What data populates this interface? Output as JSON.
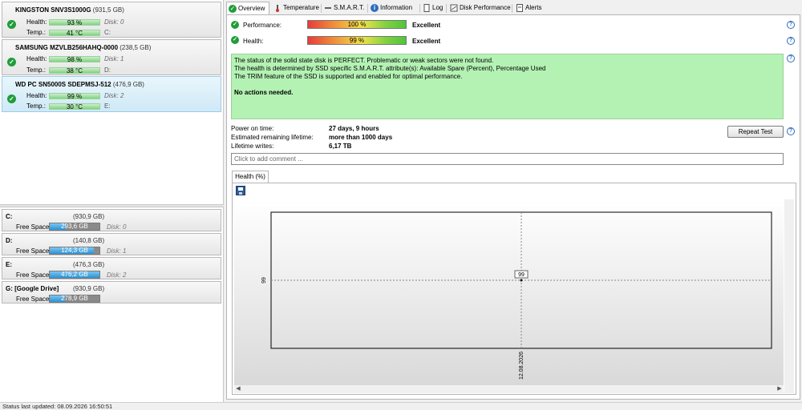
{
  "disks": [
    {
      "name": "KINGSTON SNV3S1000G",
      "size": "(931,5 GB)",
      "health_label": "Health:",
      "health": "93 %",
      "health_pct": 93,
      "temp_label": "Temp.:",
      "temp": "41 °C",
      "disk": "Disk: 0",
      "drive": "C:"
    },
    {
      "name": "SAMSUNG MZVLB256HAHQ-0000",
      "size": "(238,5 GB)",
      "health_label": "Health:",
      "health": "98 %",
      "health_pct": 98,
      "temp_label": "Temp.:",
      "temp": "38 °C",
      "disk": "Disk: 1",
      "drive": "D:"
    },
    {
      "name": "WD PC SN5000S SDEPMSJ-512",
      "size": "(476,9 GB)",
      "health_label": "Health:",
      "health": "99 %",
      "health_pct": 99,
      "temp_label": "Temp.:",
      "temp": "30 °C",
      "disk": "Disk: 2",
      "drive": "E:"
    }
  ],
  "volumes": [
    {
      "letter": "C:",
      "size": "(930,9 GB)",
      "free_label": "Free Space",
      "free": "293,6 GB",
      "free_pct": 32,
      "disk": "Disk: 0"
    },
    {
      "letter": "D:",
      "size": "(140,8 GB)",
      "free_label": "Free Space",
      "free": "124,3 GB",
      "free_pct": 88,
      "disk": "Disk: 1"
    },
    {
      "letter": "E:",
      "size": "(476,3 GB)",
      "free_label": "Free Space",
      "free": "476,2 GB",
      "free_pct": 100,
      "disk": "Disk: 2"
    },
    {
      "letter": "G: [Google Drive]",
      "size": "(930,9 GB)",
      "free_label": "Free Space",
      "free": "278,9 GB",
      "free_pct": 30,
      "disk": ""
    }
  ],
  "status_bar": "Status last updated: 08.09.2026 16:50:51",
  "tabs": [
    {
      "label": "Overview",
      "icon": "check-icon"
    },
    {
      "label": "Temperature",
      "icon": "thermometer-icon"
    },
    {
      "label": "S.M.A.R.T.",
      "icon": "smart-icon"
    },
    {
      "label": "Information",
      "icon": "info-icon"
    },
    {
      "label": "Log",
      "icon": "document-icon"
    },
    {
      "label": "Disk Performance",
      "icon": "disk-performance-icon"
    },
    {
      "label": "Alerts",
      "icon": "alerts-icon"
    }
  ],
  "overview": {
    "performance_label": "Performance:",
    "performance_value": "100 %",
    "performance_pct": 100,
    "performance_rating": "Excellent",
    "health_label": "Health:",
    "health_value": "99 %",
    "health_pct": 99,
    "health_rating": "Excellent",
    "message_lines": [
      "The status of the solid state disk is PERFECT. Problematic or weak sectors were not found.",
      "The health is determined by SSD specific S.M.A.R.T. attribute(s):  Available Spare (Percent), Percentage Used",
      "The TRIM feature of the SSD is supported and enabled for optimal performance."
    ],
    "message_action": "No actions needed.",
    "power_on_label": "Power on time:",
    "power_on_value": "27 days, 9 hours",
    "lifetime_label": "Estimated remaining lifetime:",
    "lifetime_value": "more than 1000 days",
    "writes_label": "Lifetime writes:",
    "writes_value": "6,17 TB",
    "repeat_button": "Repeat Test",
    "comment_placeholder": "Click to add comment ...",
    "help_symbol": "?",
    "ok_symbol": "✓"
  },
  "chart_tab": "Health (%)",
  "chart_data": {
    "type": "scatter",
    "x": [
      "12.08.2026"
    ],
    "y": [
      99
    ],
    "point_labels": [
      "99"
    ],
    "ytick_labels": [
      "99"
    ],
    "xtick_labels": [
      "12.08.2026"
    ],
    "title": "",
    "xlabel": "",
    "ylabel": ""
  },
  "colors": {
    "ok_green": "#1f9d3a",
    "message_bg": "#b4f2b4",
    "volume_bar": "#2b93d6"
  }
}
